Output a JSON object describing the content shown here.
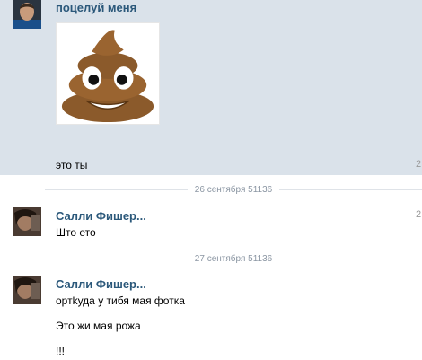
{
  "messages": [
    {
      "sender": "поцелуй меня",
      "sticker_icon": "poop-emoji-icon",
      "text": "это ты",
      "time_stub": "2"
    },
    {
      "date_separator": "26 сентября 51136",
      "sender": "Салли Фишер...",
      "text": "Што ето",
      "time_stub": "2"
    },
    {
      "date_separator": "27 сентября 51136",
      "sender": "Салли Фишер...",
      "lines": [
        "ортkуда у тибя мая фотка",
        "Это жи мая рожа",
        "!!!"
      ]
    }
  ],
  "colors": {
    "highlight_bg": "#dae2ea",
    "sender_link": "#2b587a",
    "date_text": "#8a95a2",
    "poop_brown": "#8b5a2b"
  }
}
